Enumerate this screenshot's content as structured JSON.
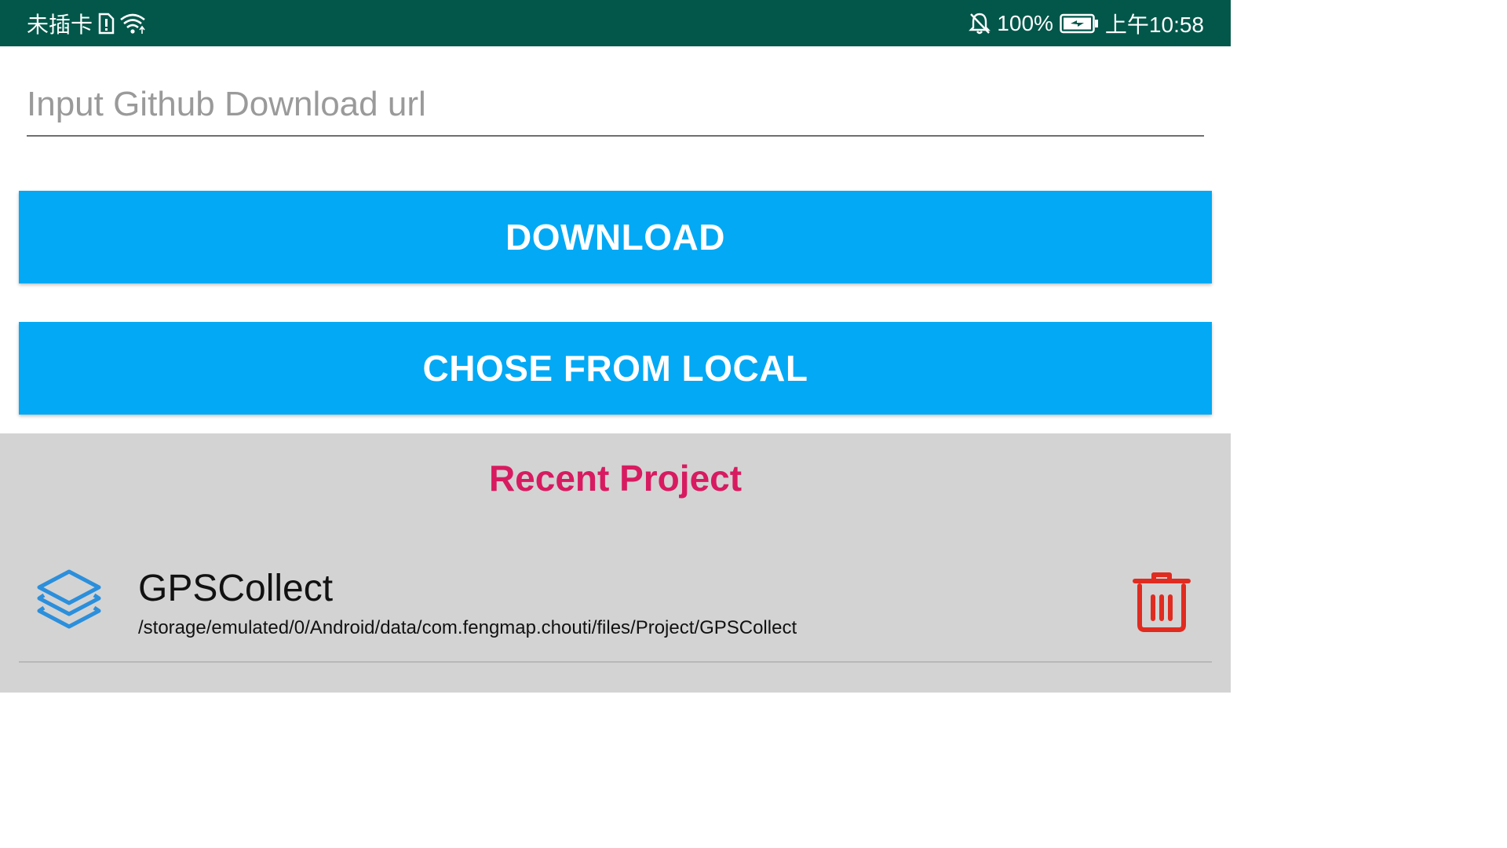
{
  "status_bar": {
    "carrier": "未插卡",
    "battery_percent": "100%",
    "time": "上午10:58",
    "icons": [
      "sim-alert-icon",
      "wifi-icon",
      "mute-bell-icon",
      "battery-charging-icon"
    ],
    "background_color": "#02574a"
  },
  "url_input": {
    "placeholder": "Input Github Download url",
    "value": ""
  },
  "buttons": {
    "download_label": "DOWNLOAD",
    "local_label": "CHOSE FROM LOCAL",
    "color": "#03a9f4"
  },
  "recent": {
    "title": "Recent Project",
    "title_color": "#d81b60",
    "background_color": "#d3d3d3",
    "items": [
      {
        "name": "GPSCollect",
        "path": "/storage/emulated/0/Android/data/com.fengmap.chouti/files/Project/GPSCollect",
        "icon": "layers-icon",
        "action_icon": "trash-icon",
        "action_color": "#e02b20"
      }
    ]
  }
}
